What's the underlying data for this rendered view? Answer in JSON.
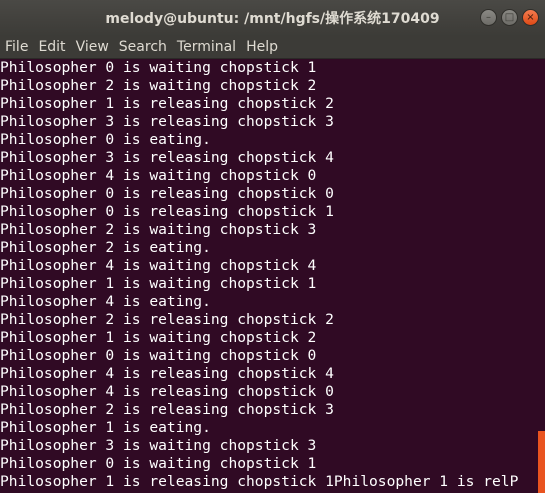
{
  "window": {
    "title": "melody@ubuntu: /mnt/hgfs/操作系统170409"
  },
  "controls": {
    "minimize_icon": "–",
    "maximize_icon": "□",
    "close_icon": "×"
  },
  "menu": {
    "items": [
      "File",
      "Edit",
      "View",
      "Search",
      "Terminal",
      "Help"
    ]
  },
  "terminal": {
    "lines": [
      "Philosopher 0 is waiting chopstick 1",
      "Philosopher 2 is waiting chopstick 2",
      "Philosopher 1 is releasing chopstick 2",
      "Philosopher 3 is releasing chopstick 3",
      "Philosopher 0 is eating.",
      "Philosopher 3 is releasing chopstick 4",
      "Philosopher 4 is waiting chopstick 0",
      "Philosopher 0 is releasing chopstick 0",
      "Philosopher 0 is releasing chopstick 1",
      "Philosopher 2 is waiting chopstick 3",
      "Philosopher 2 is eating.",
      "Philosopher 4 is waiting chopstick 4",
      "Philosopher 1 is waiting chopstick 1",
      "Philosopher 4 is eating.",
      "Philosopher 2 is releasing chopstick 2",
      "Philosopher 1 is waiting chopstick 2",
      "Philosopher 0 is waiting chopstick 0",
      "Philosopher 4 is releasing chopstick 4",
      "Philosopher 4 is releasing chopstick 0",
      "Philosopher 2 is releasing chopstick 3",
      "Philosopher 1 is eating.",
      "Philosopher 3 is waiting chopstick 3",
      "Philosopher 0 is waiting chopstick 1",
      "Philosopher 1 is releasing chopstick 1Philosopher 1 is relP"
    ]
  },
  "colors": {
    "terminal_bg": "#300a24",
    "terminal_fg": "#ffffff",
    "scroll_accent": "#e95420"
  }
}
